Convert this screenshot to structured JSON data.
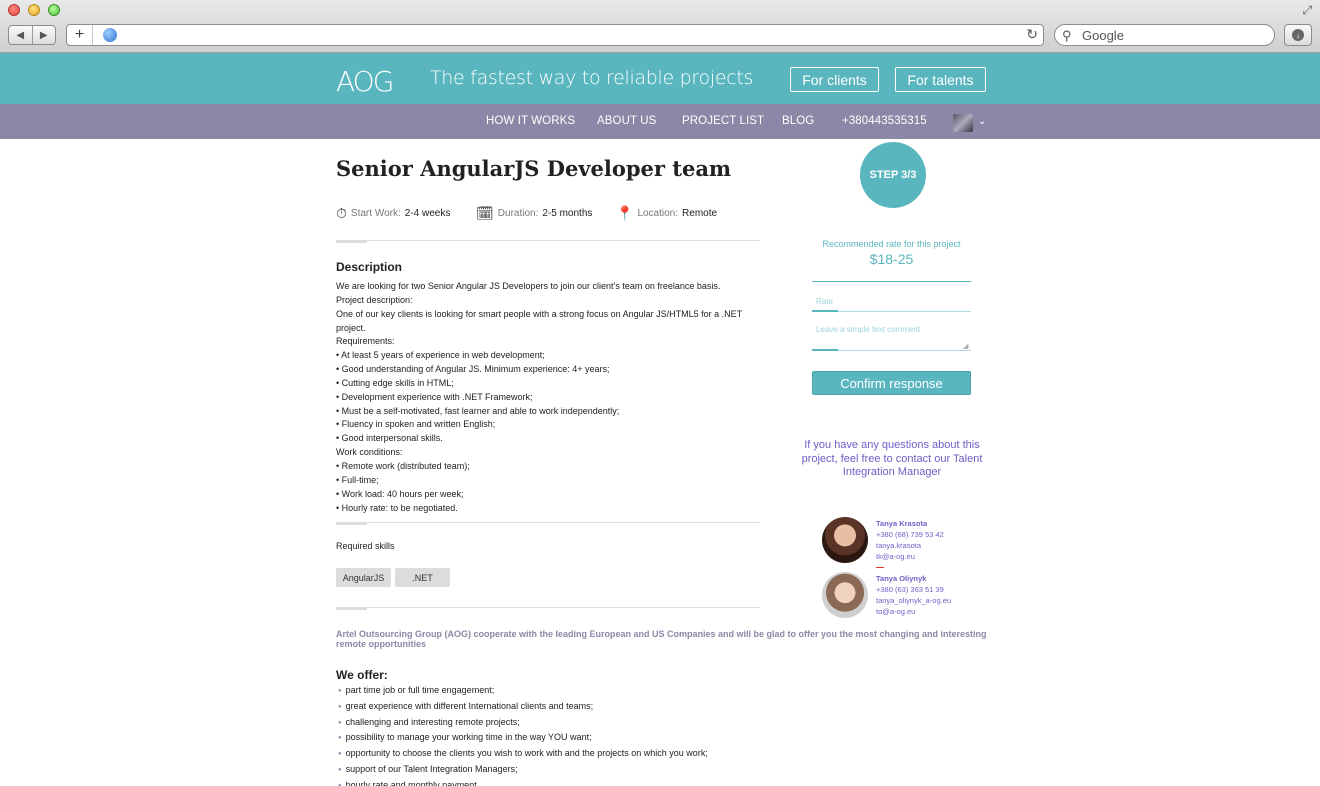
{
  "browser": {
    "search_placeholder": "Google"
  },
  "header": {
    "logo": "AOG",
    "tagline": "The fastest way to reliable projects",
    "for_clients": "For clients",
    "for_talents": "For talents"
  },
  "nav": {
    "items": [
      "HOW IT WORKS",
      "ABOUT US",
      "PROJECT LIST",
      "BLOG",
      "+380443535315"
    ]
  },
  "project": {
    "title": "Senior AngularJS Developer team",
    "start_label": "Start Work:",
    "start_value": "2-4 weeks",
    "duration_label": "Duration:",
    "duration_value": "2-5 months",
    "location_label": "Location:",
    "location_value": "Remote",
    "description_title": "Description",
    "description_lines": [
      "We are looking for two Senior Angular JS Developers to join our client’s team on freelance basis.",
      "Project description:",
      "One of our key clients is looking for smart people with a strong focus on Angular JS/HTML5 for a .NET",
      "project.",
      "Requirements:",
      "• At least 5 years of experience in web development;",
      "• Good understanding of Angular JS. Minimum experience: 4+ years;",
      "• Cutting edge skills in HTML;",
      "• Development experience with .NET Framework;",
      "• Must be a self-motivated, fast learner and able to work independently;",
      "• Fluency in spoken and written English;",
      "• Good interpersonal skills.",
      "Work conditions:",
      "• Remote work (distributed team);",
      "• Full-time;",
      "• Work load: 40 hours per week;",
      "• Hourly rate: to be negotiated."
    ],
    "skills_title": "Required skills",
    "skills": [
      "AngularJS",
      ".NET"
    ],
    "aog_text": "Artel Outsourcing Group (AOG) cooperate with the leading European and US Companies and will be glad to offer you the most changing and interesting remote opportunities",
    "offer_title": "We offer:",
    "offer_items": [
      "part time job or full time engagement;",
      "great experience with different International clients and teams;",
      "challenging and interesting remote projects;",
      "possibility to manage your working time in the way YOU want;",
      "opportunity to choose the clients you wish to work with and the projects on which you work;",
      "support of our Talent Integration Managers;",
      "hourly rate and monthly payment"
    ]
  },
  "side": {
    "step": "STEP 3/3",
    "rate_label": "Recommended rate for this project",
    "rate_value": "$18-25",
    "rate_placeholder": "Rate",
    "comment_placeholder": "Leave a simple text comment",
    "confirm": "Confirm response",
    "questions": "If you have any questions about this project, feel free to contact our Talent Integration Manager",
    "managers": [
      {
        "name": "Tanya Krasota",
        "phone": "+380 (68) 739 53 42",
        "skype": "tanya.krasota",
        "email": "tk@a-og.eu"
      },
      {
        "name": "Tanya Oliynyk",
        "phone": "+380 (63) 363 51 39",
        "skype": "tanya_oliynyk_a-og.eu",
        "email": "to@a-og.eu"
      }
    ]
  },
  "colors": {
    "teal": "#5ab6be",
    "purple_nav": "#8c87a6",
    "contact_text": "#6f5fc9"
  }
}
